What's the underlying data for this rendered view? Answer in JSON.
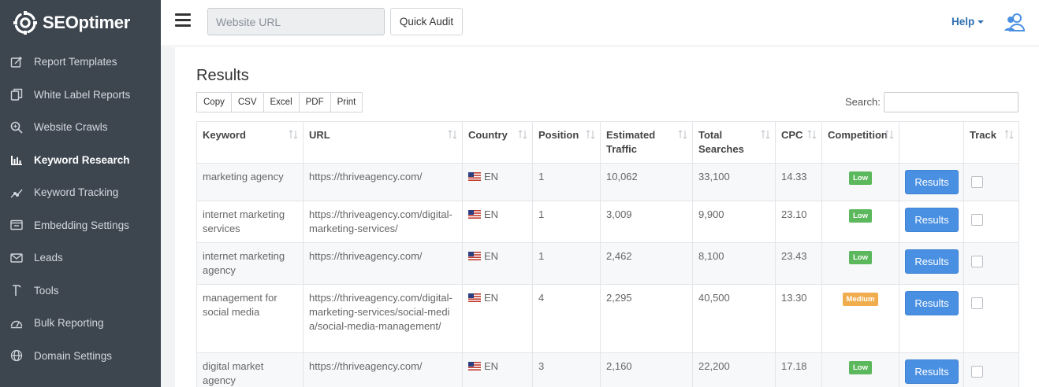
{
  "brand": {
    "name": "SEOptimer",
    "icon": "gear-logo-icon"
  },
  "sidebar": {
    "items": [
      {
        "label": "Report Templates",
        "icon": "edit-icon",
        "active": false
      },
      {
        "label": "White Label Reports",
        "icon": "copy-icon",
        "active": false
      },
      {
        "label": "Website Crawls",
        "icon": "search-icon",
        "active": false
      },
      {
        "label": "Keyword Research",
        "icon": "bar-chart-icon",
        "active": true
      },
      {
        "label": "Keyword Tracking",
        "icon": "trend-icon",
        "active": false
      },
      {
        "label": "Embedding Settings",
        "icon": "embed-icon",
        "active": false
      },
      {
        "label": "Leads",
        "icon": "envelope-icon",
        "active": false
      },
      {
        "label": "Tools",
        "icon": "tools-icon",
        "active": false
      },
      {
        "label": "Bulk Reporting",
        "icon": "dashboard-icon",
        "active": false
      },
      {
        "label": "Domain Settings",
        "icon": "globe-icon",
        "active": false
      }
    ]
  },
  "topbar": {
    "url_placeholder": "Website URL",
    "quick_audit_label": "Quick Audit",
    "help_label": "Help"
  },
  "main": {
    "title": "Results",
    "export_buttons": [
      "Copy",
      "CSV",
      "Excel",
      "PDF",
      "Print"
    ],
    "search_label": "Search:",
    "columns": [
      "Keyword",
      "URL",
      "Country",
      "Position",
      "Estimated Traffic",
      "Total Searches",
      "CPC",
      "Competition",
      "",
      "Track"
    ],
    "results_button_label": "Results",
    "rows": [
      {
        "keyword": "marketing agency",
        "url": "https://thriveagency.com/",
        "country": "EN",
        "position": "1",
        "traffic": "10,062",
        "searches": "33,100",
        "cpc": "14.33",
        "competition": "Low"
      },
      {
        "keyword": "internet marketing services",
        "url": "https://thriveagency.com/digital-marketing-services/",
        "country": "EN",
        "position": "1",
        "traffic": "3,009",
        "searches": "9,900",
        "cpc": "23.10",
        "competition": "Low"
      },
      {
        "keyword": "internet marketing agency",
        "url": "https://thriveagency.com/",
        "country": "EN",
        "position": "1",
        "traffic": "2,462",
        "searches": "8,100",
        "cpc": "23.43",
        "competition": "Low"
      },
      {
        "keyword": "management for social media",
        "url": "https://thriveagency.com/digital-marketing-services/social-media/social-media-management/",
        "country": "EN",
        "position": "4",
        "traffic": "2,295",
        "searches": "40,500",
        "cpc": "13.30",
        "competition": "Medium"
      },
      {
        "keyword": "digital market agency",
        "url": "https://thriveagency.com/",
        "country": "EN",
        "position": "3",
        "traffic": "2,160",
        "searches": "22,200",
        "cpc": "17.18",
        "competition": "Low"
      }
    ]
  },
  "colors": {
    "sidebar_bg": "#3d454f",
    "accent_blue": "#4a90e2",
    "badge_low": "#5cb85c",
    "badge_medium": "#f0ad4e",
    "help_link": "#2f6fb0"
  }
}
